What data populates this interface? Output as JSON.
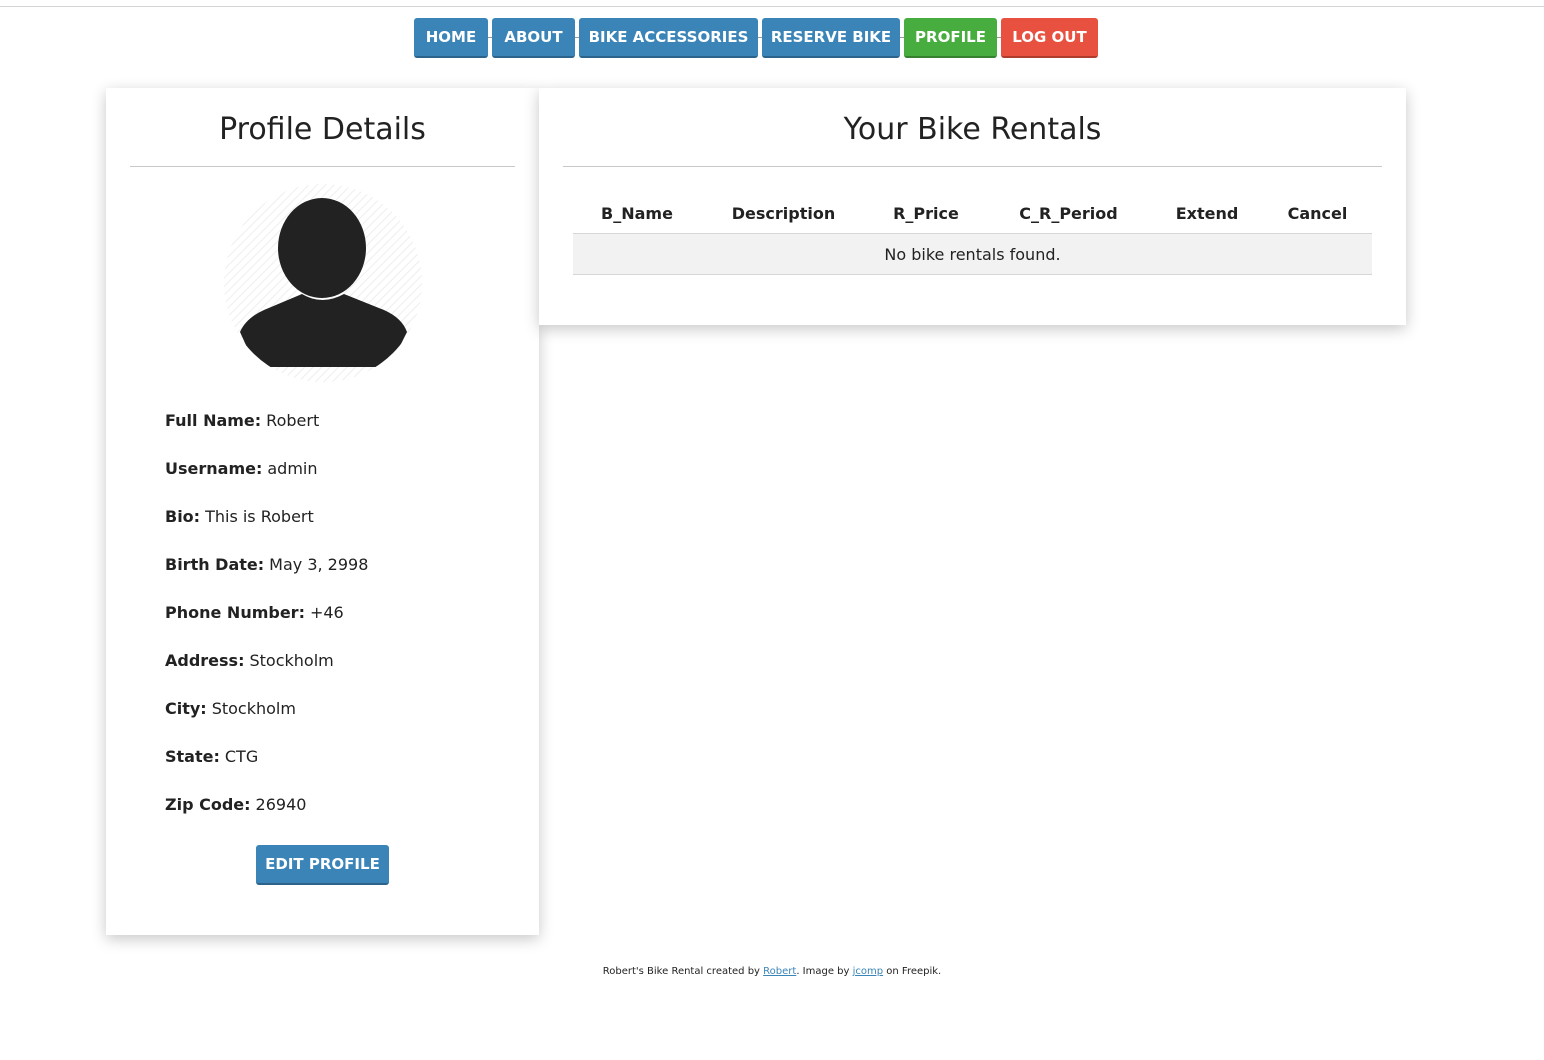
{
  "nav": {
    "home": "HOME",
    "about": "ABOUT",
    "bike_accessories": "BIKE ACCESSORIES",
    "reserve_bike": "RESERVE BIKE",
    "profile": "PROFILE",
    "logout": "LOG OUT"
  },
  "colors": {
    "nav_blue": "#3a84b8",
    "nav_active_green": "#47ad3f",
    "logout_red": "#e8503f"
  },
  "profile": {
    "title": "Profile Details",
    "avatar_icon": "user-silhouette-icon",
    "fields": [
      {
        "label": "Full Name:",
        "value": "Robert"
      },
      {
        "label": "Username:",
        "value": "admin"
      },
      {
        "label": "Bio:",
        "value": "This is Robert"
      },
      {
        "label": "Birth Date:",
        "value": "May 3, 2998"
      },
      {
        "label": "Phone Number:",
        "value": "+46"
      },
      {
        "label": "Address:",
        "value": "Stockholm"
      },
      {
        "label": "City:",
        "value": "Stockholm"
      },
      {
        "label": "State:",
        "value": "CTG"
      },
      {
        "label": "Zip Code:",
        "value": "26940"
      }
    ],
    "edit_button": "EDIT PROFILE"
  },
  "rentals": {
    "title": "Your Bike Rentals",
    "columns": [
      "B_Name",
      "Description",
      "R_Price",
      "C_R_Period",
      "Extend",
      "Cancel"
    ],
    "empty_message": "No bike rentals found."
  },
  "footer": {
    "prefix": "Robert's Bike Rental created by ",
    "author_link": "Robert",
    "middle": ". Image by ",
    "image_link": "jcomp",
    "suffix": " on Freepik."
  }
}
